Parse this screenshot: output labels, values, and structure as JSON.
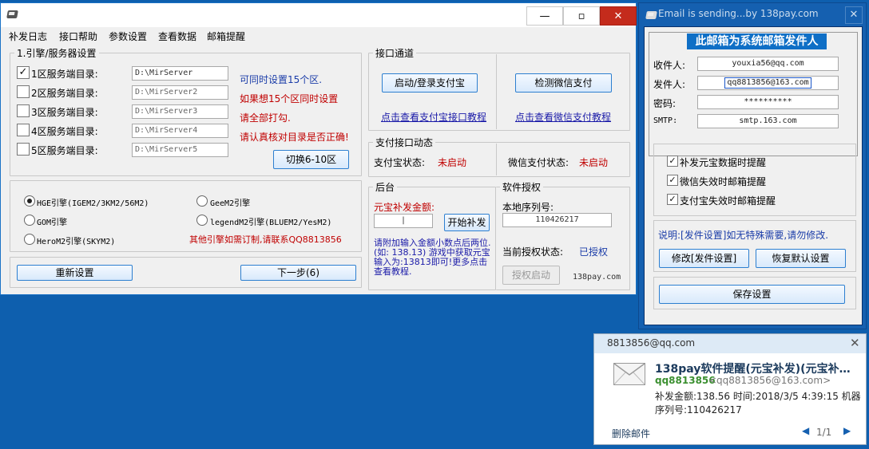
{
  "main": {
    "close_icon": "✕",
    "max_icon": "▫",
    "min_icon": "—",
    "menu": [
      "补发日志",
      "接口帮助",
      "参数设置",
      "查看数据",
      "邮箱提醒"
    ],
    "engine_group": "1.引擎/服务器设置",
    "servers": [
      {
        "label": "1区服务端目录:",
        "value": "D:\\MirServer",
        "checked": true
      },
      {
        "label": "2区服务端目录:",
        "value": "D:\\MirServer2",
        "checked": false
      },
      {
        "label": "3区服务端目录:",
        "value": "D:\\MirServer3",
        "checked": false
      },
      {
        "label": "4区服务端目录:",
        "value": "D:\\MirServer4",
        "checked": false
      },
      {
        "label": "5区服务端目录:",
        "value": "D:\\MirServer5",
        "checked": false
      }
    ],
    "check_mark": "✓",
    "info": [
      "可同时设置15个区.",
      "如果想15个区同时设置",
      "请全部打勾.",
      "请认真核对目录是否正确!"
    ],
    "switch_btn": "切换6-10区",
    "engines": [
      "HGE引擎(IGEM2/3KM2/56M2)",
      "GeeM2引擎",
      "GOM引擎",
      "legendM2引擎(BLUEM2/YesM2)",
      "HeroM2引擎(SKYM2)"
    ],
    "custom_note": "其他引擎如需订制,请联系QQ8813856",
    "reset_btn": "重新设置",
    "next_btn": "下一步(6)",
    "iface_group": "接口通道",
    "alipay_btn": "启动/登录支付宝",
    "wechat_btn": "检测微信支付",
    "alipay_link": "点击查看支付宝接口教程",
    "wechat_link": "点击查看微信支付教程",
    "status_group": "支付接口动态",
    "alipay_status_label": "支付宝状态:",
    "alipay_status": "未启动",
    "wechat_status_label": "微信支付状态:",
    "wechat_status": "未启动",
    "backend_group": "后台",
    "amount_label": "元宝补发金额:",
    "amount_value": "|",
    "start_btn": "开始补发",
    "backend_note": "请附加输入金额小数点后两位.(如: 138.13) 游戏中获取元宝输入为:13813即可!更多点击查看教程.",
    "license_group": "软件授权",
    "serial_label": "本地序列号:",
    "serial_value": "110426217",
    "auth_label": "当前授权状态:",
    "auth_value": "已授权",
    "auth_btn": "授权启动",
    "site": "138pay.com"
  },
  "email": {
    "title": "Email is sending...by 138pay.com",
    "banner": "此邮箱为系统邮箱发件人",
    "recipient_label": "收件人:",
    "recipient": "youxia56@qq.com",
    "sender_label": "发件人:",
    "sender": "qq8813856@163.com",
    "password_label": "密码:",
    "password": "**********",
    "smtp_label": "SMTP:",
    "smtp": "smtp.163.com",
    "options": [
      "补发元宝数据时提醒",
      "微信失效时邮箱提醒",
      "支付宝失效时邮箱提醒"
    ],
    "note": "说明:[发件设置]如无特殊需要,请勿修改.",
    "modify_btn": "修改[发件设置]",
    "restore_btn": "恢复默认设置",
    "save_btn": "保存设置"
  },
  "toast": {
    "account": "8813856@qq.com",
    "subject": "138pay软件提醒(元宝补发)(元宝补…",
    "from_name": "qq8813856",
    "from_addr": "<qq8813856@163.com>",
    "body1": "补发金额:138.56 时间:2018/3/5 4:39:15 机器",
    "body2": "序列号:110426217",
    "delete": "删除邮件",
    "pager": "1/1"
  }
}
